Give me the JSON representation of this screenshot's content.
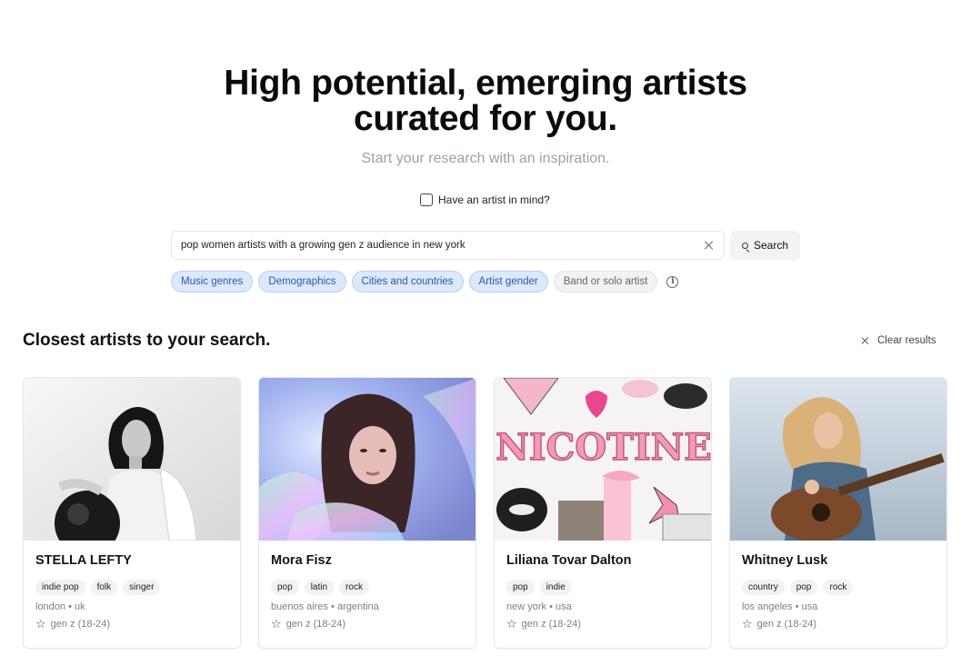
{
  "hero": {
    "title_line1": "High potential, emerging artists",
    "title_line2": "curated for you.",
    "subtitle": "Start your research with an inspiration."
  },
  "artist_in_mind": {
    "label": "Have an artist in mind?",
    "checked": false
  },
  "search": {
    "value": "pop women artists with a growing gen z audience in new york",
    "button_label": "Search"
  },
  "filters": [
    {
      "label": "Music genres",
      "active": true
    },
    {
      "label": "Demographics",
      "active": true
    },
    {
      "label": "Cities and countries",
      "active": true
    },
    {
      "label": "Artist gender",
      "active": true
    },
    {
      "label": "Band or solo artist",
      "active": false
    }
  ],
  "results": {
    "title": "Closest artists to your search.",
    "clear_label": "Clear results"
  },
  "artists": [
    {
      "name": "STELLA LEFTY",
      "tags": [
        "indie pop",
        "folk",
        "singer"
      ],
      "location": "london • uk",
      "audience": "gen z (18-24)"
    },
    {
      "name": "Mora Fisz",
      "tags": [
        "pop",
        "latin",
        "rock"
      ],
      "location": "buenos aires • argentina",
      "audience": "gen z (18-24)"
    },
    {
      "name": "Liliana Tovar Dalton",
      "tags": [
        "pop",
        "indie"
      ],
      "location": "new york • usa",
      "audience": "gen z (18-24)"
    },
    {
      "name": "Whitney Lusk",
      "tags": [
        "country",
        "pop",
        "rock"
      ],
      "location": "los angeles • usa",
      "audience": "gen z (18-24)"
    }
  ],
  "collage_text": "NICOTINE",
  "colors": {
    "chip_active_bg": "#dce8fb",
    "chip_active_text": "#2a5aa8",
    "subtitle": "#9ba1ab"
  }
}
